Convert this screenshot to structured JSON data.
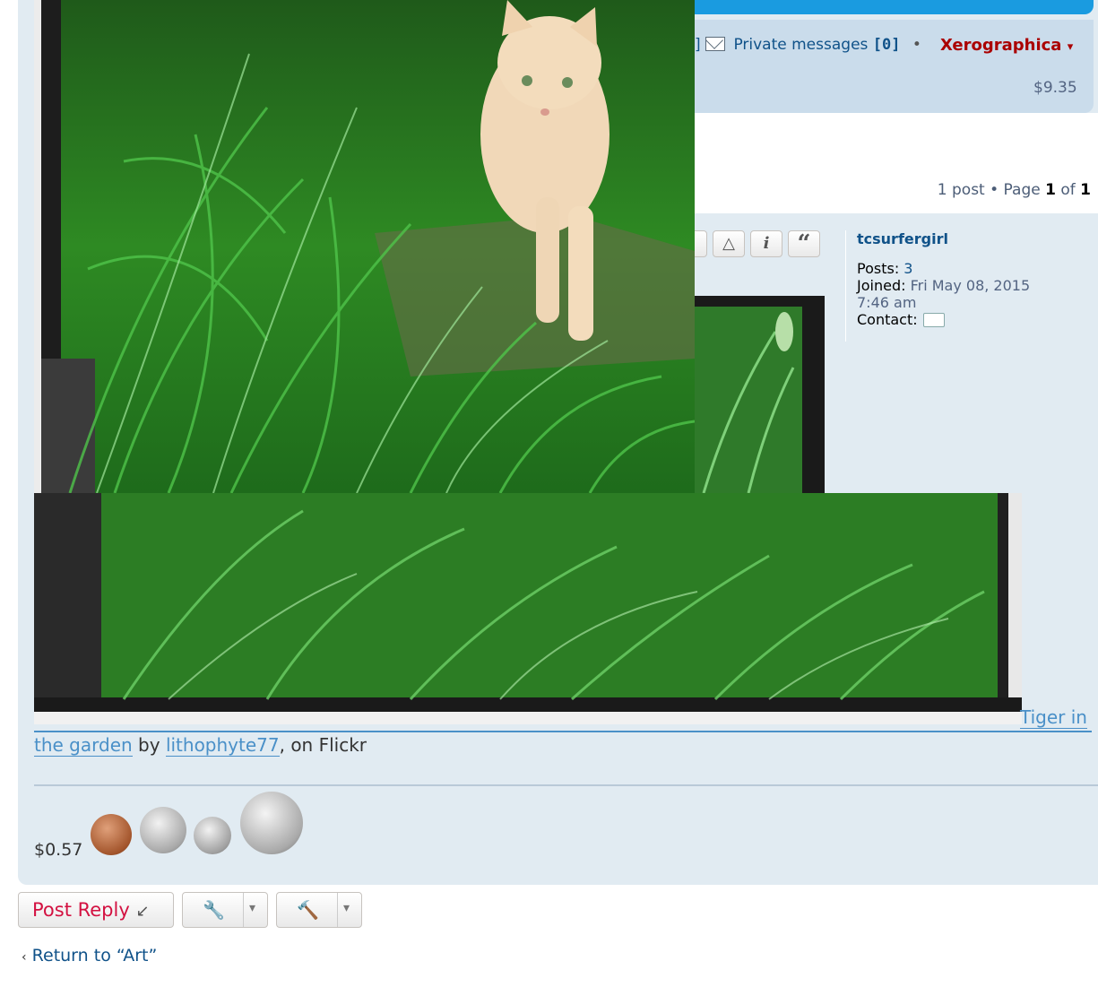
{
  "header": {
    "pm_label": "Private messages",
    "pm_count": "[0]",
    "pm_prev": "]",
    "separator": "•",
    "username": "Xerographica",
    "username_caret": "▾",
    "balance": "$9.35"
  },
  "pagination": {
    "text_pre": "1 post • Page ",
    "current": "1",
    "of": " of ",
    "total": "1"
  },
  "post_actions": [
    {
      "icon": "report-icon",
      "glyph": "△"
    },
    {
      "icon": "info-icon",
      "glyph": "i"
    },
    {
      "icon": "quote-icon",
      "glyph": "“"
    }
  ],
  "profile": {
    "username": "tcsurfergirl",
    "posts_label": "Posts:",
    "posts_value": "3",
    "joined_label": "Joined:",
    "joined_value": "Fri May 08, 2015",
    "joined_time": "7:46 am",
    "contact_label": "Contact:"
  },
  "post": {
    "link_title_1": "Tiger in",
    "link_title_2": "the garden",
    "by": "by",
    "author": "lithophyte77",
    "on_flickr": ", on Flickr",
    "money": "$0.57"
  },
  "actions": {
    "post_reply": "Post Reply",
    "return_link": "Return to “Art”"
  },
  "colors": {
    "panel": "#e1ebf2",
    "accent": "#105289",
    "link": "#4a90c8",
    "user": "#aa0000",
    "reply": "#d31141"
  }
}
